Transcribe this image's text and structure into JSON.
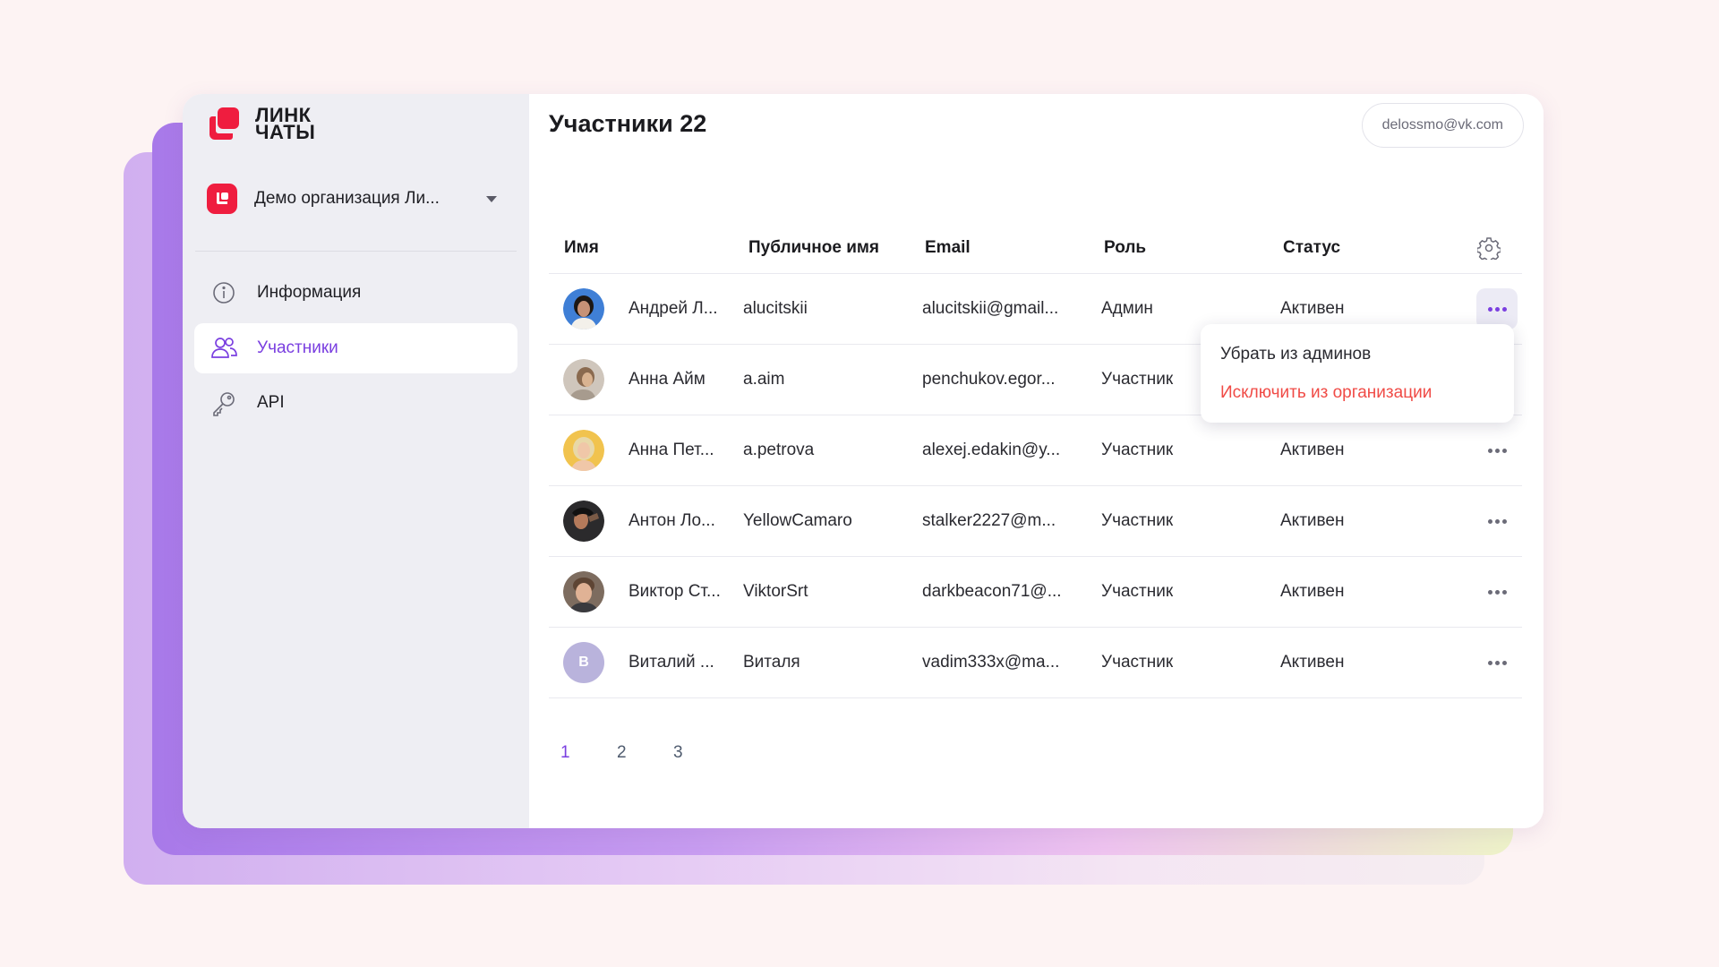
{
  "logo": {
    "line1": "ЛИНК",
    "line2": "ЧАТЫ"
  },
  "organization": {
    "name": "Демо организация Ли..."
  },
  "sidebar": {
    "items": [
      {
        "label": "Информация",
        "icon": "info-icon"
      },
      {
        "label": "Участники",
        "icon": "users-icon",
        "active": true
      },
      {
        "label": "API",
        "icon": "key-icon"
      }
    ]
  },
  "header": {
    "title": "Участники 22",
    "user_email": "delossmo@vk.com"
  },
  "table": {
    "columns": [
      "Имя",
      "Публичное имя",
      "Email",
      "Роль",
      "Статус"
    ],
    "rows": [
      {
        "name": "Андрей Л...",
        "public_name": "alucitskii",
        "email": "alucitskii@gmail...",
        "role": "Админ",
        "status": "Активен"
      },
      {
        "name": "Анна Айм",
        "public_name": "a.aim",
        "email": "penchukov.egor...",
        "role": "Участник",
        "status": ""
      },
      {
        "name": "Анна Пет...",
        "public_name": "a.petrova",
        "email": "alexej.edakin@y...",
        "role": "Участник",
        "status": "Активен"
      },
      {
        "name": "Антон Ло...",
        "public_name": "YellowCamaro",
        "email": "stalker2227@m...",
        "role": "Участник",
        "status": "Активен"
      },
      {
        "name": "Виктор Ст...",
        "public_name": "ViktorSrt",
        "email": "darkbeacon71@...",
        "role": "Участник",
        "status": "Активен"
      },
      {
        "name": "Виталий ...",
        "public_name": "Виталя",
        "email": "vadim333x@ma...",
        "role": "Участник",
        "status": "Активен",
        "avatar_letter": "В"
      }
    ]
  },
  "context_menu": {
    "items": [
      "Убрать из админов",
      "Исключить из организации"
    ]
  },
  "pagination": {
    "pages": [
      "1",
      "2",
      "3"
    ],
    "current": "1"
  },
  "colors": {
    "accent": "#7a3fe0",
    "brand": "#ef1d3f",
    "danger": "#f04b46"
  }
}
